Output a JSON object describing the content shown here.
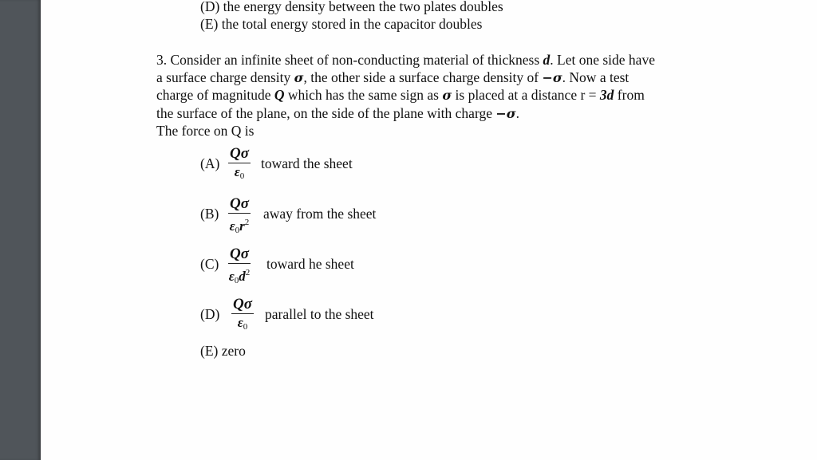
{
  "viewer": {
    "sidebar_color": "#50555a",
    "page_color": "#fefefe"
  },
  "previous_question": {
    "options": [
      {
        "letter": "(D)",
        "text": "the energy density between the two plates doubles"
      },
      {
        "letter": "(E)",
        "text": "the total energy stored in the capacitor doubles"
      }
    ]
  },
  "question": {
    "number": "3.",
    "line1_a": "Consider an infinite sheet of non-conducting material of thickness ",
    "line1_var": "d",
    "line1_b": ". Let one side have",
    "line2_a": "a surface charge density ",
    "sigma": "σ",
    "line2_b": ", the other side a surface charge density of ",
    "neg_sigma": "−σ",
    "line2_c": ". Now a test",
    "line3_a": "charge of magnitude ",
    "line3_var": "Q",
    "line3_b": " which has the same sign as ",
    "line3_c": " is placed at a distance r = ",
    "line3_dist": "3d",
    "line3_d": " from",
    "line4_a": "the surface of the plane, on the side of the plane with charge ",
    "line4_b": ".",
    "line5": "The force on Q is"
  },
  "answers": [
    {
      "letter": "(A)",
      "numerator": "Qσ",
      "denominator": "ε",
      "den_sub": "0",
      "den_var": "",
      "den_sup": "",
      "text": "toward the sheet"
    },
    {
      "letter": "(B)",
      "numerator": "Qσ",
      "denominator": "ε",
      "den_sub": "0",
      "den_var": "r",
      "den_sup": "2",
      "text": "away from the sheet"
    },
    {
      "letter": "(C)",
      "numerator": "Qσ",
      "denominator": "ε",
      "den_sub": "0",
      "den_var": "d",
      "den_sup": "2",
      "text": "toward he sheet"
    },
    {
      "letter": "(D)",
      "numerator": "Qσ",
      "denominator": "ε",
      "den_sub": "0",
      "den_var": "",
      "den_sup": "",
      "text": "parallel to the sheet"
    },
    {
      "letter": "(E)",
      "text": "zero"
    }
  ]
}
